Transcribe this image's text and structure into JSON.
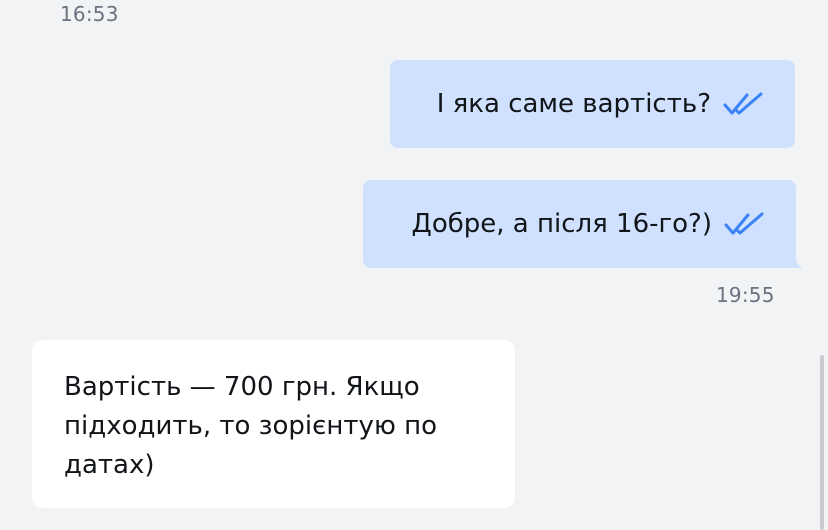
{
  "timestamps": {
    "top": "16:53",
    "middle": "19:55"
  },
  "messages": {
    "outgoing": [
      {
        "text": "І яка саме вартість?",
        "status_icon": "double-check-icon"
      },
      {
        "text": "Добре, а після 16-го?)",
        "status_icon": "double-check-icon"
      }
    ],
    "incoming": [
      {
        "text": "Вартість — 700 грн. Якщо підходить, то зорієнтую по датах)"
      }
    ]
  },
  "colors": {
    "background": "#f2f3f5",
    "outgoing_bubble": "#cfe1ff",
    "incoming_bubble": "#ffffff",
    "read_check": "#3b82f6",
    "timestamp": "#6b7280"
  }
}
